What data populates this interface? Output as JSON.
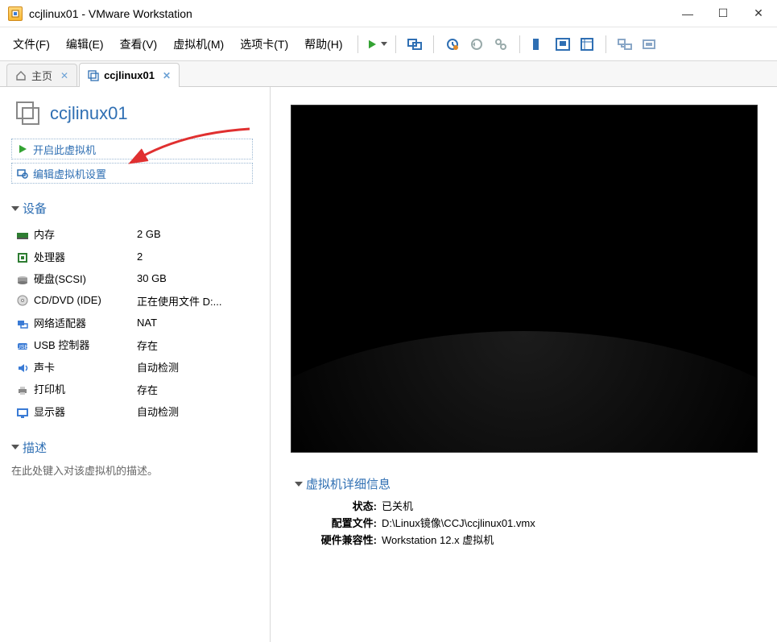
{
  "window": {
    "title": "ccjlinux01 - VMware Workstation"
  },
  "menu": {
    "file": "文件(F)",
    "edit": "编辑(E)",
    "view": "查看(V)",
    "vm": "虚拟机(M)",
    "tabs": "选项卡(T)",
    "help": "帮助(H)"
  },
  "tabs": {
    "home": "主页",
    "active": "ccjlinux01"
  },
  "vm": {
    "name": "ccjlinux01",
    "power_on": "开启此虚拟机",
    "edit_settings": "编辑虚拟机设置"
  },
  "sections": {
    "devices": "设备",
    "description": "描述",
    "description_placeholder": "在此处键入对该虚拟机的描述。",
    "details": "虚拟机详细信息"
  },
  "devices": [
    {
      "label": "内存",
      "value": "2 GB",
      "icon": "memory"
    },
    {
      "label": "处理器",
      "value": "2",
      "icon": "cpu"
    },
    {
      "label": "硬盘(SCSI)",
      "value": "30 GB",
      "icon": "hdd"
    },
    {
      "label": "CD/DVD (IDE)",
      "value": "正在使用文件 D:...",
      "icon": "cd"
    },
    {
      "label": "网络适配器",
      "value": "NAT",
      "icon": "net"
    },
    {
      "label": "USB 控制器",
      "value": "存在",
      "icon": "usb"
    },
    {
      "label": "声卡",
      "value": "自动检测",
      "icon": "sound"
    },
    {
      "label": "打印机",
      "value": "存在",
      "icon": "printer"
    },
    {
      "label": "显示器",
      "value": "自动检测",
      "icon": "display"
    }
  ],
  "details": {
    "state_k": "状态:",
    "state_v": "已关机",
    "config_k": "配置文件:",
    "config_v": "D:\\Linux镜像\\CCJ\\ccjlinux01.vmx",
    "compat_k": "硬件兼容性:",
    "compat_v": "Workstation 12.x 虚拟机"
  }
}
